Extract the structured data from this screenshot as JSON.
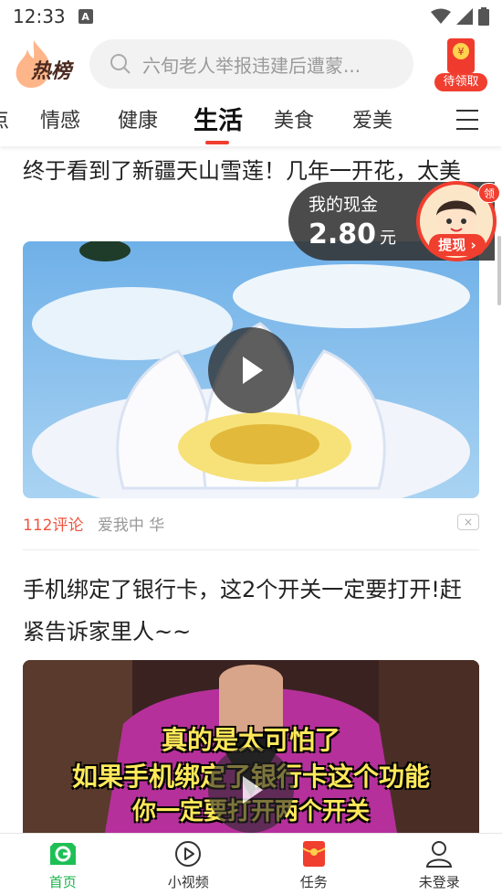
{
  "status_bar": {
    "time": "12:33",
    "notification_icon": "A"
  },
  "header": {
    "logo_text": "热榜",
    "search_placeholder": "六旬老人举报违建后遭蒙...",
    "redpack_label": "待领取"
  },
  "tabs": {
    "partial_left": "点",
    "items": [
      "情感",
      "健康",
      "生活",
      "美食",
      "爱美"
    ],
    "active": "生活"
  },
  "feed": [
    {
      "title": "终于看到了新疆天山雪莲！几年一开花，太美",
      "comments": "112评论",
      "author": "爱我中 华",
      "dismiss": "×"
    },
    {
      "title": "手机绑定了银行卡，这2个开关一定要打开!赶紧告诉家里人~~",
      "video_caption_lines": [
        "真的是太可怕了",
        "如果手机绑定了银行卡这个功能",
        "你一定要打开两个开关"
      ]
    }
  ],
  "cash_widget": {
    "label": "我的现金",
    "amount": "2.80",
    "unit": "元",
    "withdraw": "提现",
    "badge": "领"
  },
  "bottom_nav": [
    {
      "label": "首页",
      "icon": "home-icon",
      "active": true
    },
    {
      "label": "小视频",
      "icon": "play-circle-icon"
    },
    {
      "label": "任务",
      "icon": "red-envelope-icon"
    },
    {
      "label": "未登录",
      "icon": "user-icon"
    }
  ],
  "colors": {
    "accent": "#f03e2f",
    "active_nav": "#18b24a"
  }
}
